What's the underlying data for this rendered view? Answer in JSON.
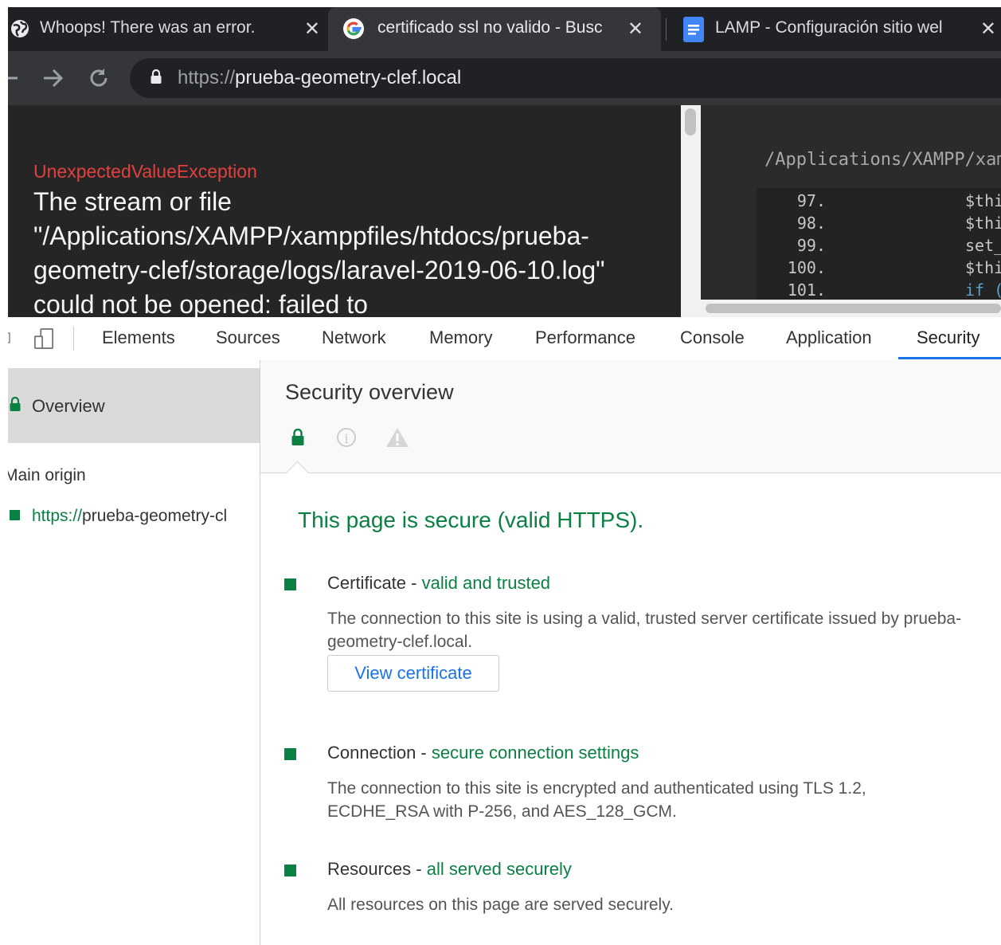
{
  "browser": {
    "tabs": [
      {
        "title": "Whoops! There was an error.",
        "icon": "globe-icon",
        "active": false
      },
      {
        "title": "certificado ssl no valido - Busc",
        "icon": "google-icon",
        "active": true
      },
      {
        "title": "LAMP - Configuración sitio wel",
        "icon": "docs-icon",
        "active": false
      }
    ],
    "close_glyph": "✕",
    "address": {
      "scheme": "https://",
      "host": "prueba-geometry-clef.local"
    }
  },
  "page": {
    "exception_name": "UnexpectedValueException",
    "exception_message": "The stream or file \"/Applications/XAMPP/xamppfiles/htdocs/prueba-geometry-clef/storage/logs/laravel-2019-06-10.log\" could not be opened: failed to",
    "code_path": "/Applications/XAMPP/xam",
    "code_lines": [
      {
        "num": "97.",
        "text": "$thi"
      },
      {
        "num": "98.",
        "text": "$thi"
      },
      {
        "num": "99.",
        "text": "set_"
      },
      {
        "num": "100.",
        "text": "$thi"
      },
      {
        "num": "101.",
        "text": "if ("
      }
    ]
  },
  "devtools": {
    "tabs": [
      "Elements",
      "Sources",
      "Network",
      "Memory",
      "Performance",
      "Console",
      "Application",
      "Security"
    ],
    "active_tab": "Security",
    "sidebar": {
      "overview_label": "Overview",
      "main_origin_heading": "Main origin",
      "origin_scheme": "https://",
      "origin_host": "prueba-geometry-cl"
    },
    "main": {
      "title": "Security overview",
      "summary": "This page is secure (valid HTTPS).",
      "sections": [
        {
          "label": "Certificate",
          "status": "valid and trusted",
          "description": "The connection to this site is using a valid, trusted server certificate issued by prueba-geometry-clef.local.",
          "button": "View certificate"
        },
        {
          "label": "Connection",
          "status": "secure connection settings",
          "description": "The connection to this site is encrypted and authenticated using TLS 1.2, ECDHE_RSA with P-256, and AES_128_GCM."
        },
        {
          "label": "Resources",
          "status": "all served securely",
          "description": "All resources on this page are served securely."
        }
      ]
    }
  },
  "colors": {
    "secure_green": "#0b8043",
    "accent_blue": "#1a73e8",
    "exception_red": "#e0413e",
    "chrome_dark": "#202124"
  }
}
